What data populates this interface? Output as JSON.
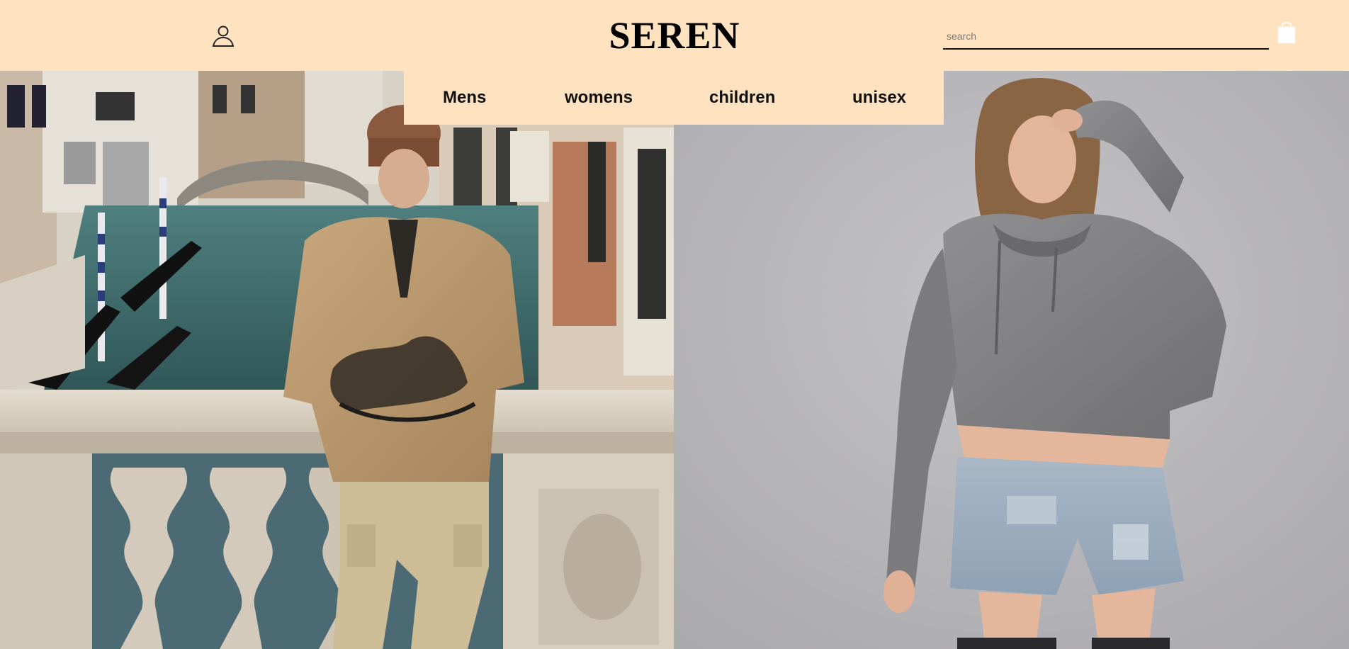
{
  "header": {
    "logo": "SEREN",
    "account_icon": "user-icon",
    "search": {
      "placeholder": "search",
      "value": ""
    },
    "cart_icon": "shopping-bag-icon"
  },
  "nav": {
    "items": [
      {
        "label": "Mens"
      },
      {
        "label": "womens"
      },
      {
        "label": "children"
      },
      {
        "label": "unisex"
      }
    ]
  },
  "hero": {
    "left_image": "man-in-fleece-venice-canal-photo",
    "right_image": "woman-in-grey-crop-hoodie-photo"
  },
  "colors": {
    "header_bg": "#ffe3c0",
    "text": "#111111",
    "right_bg": "#b9b8bc"
  }
}
